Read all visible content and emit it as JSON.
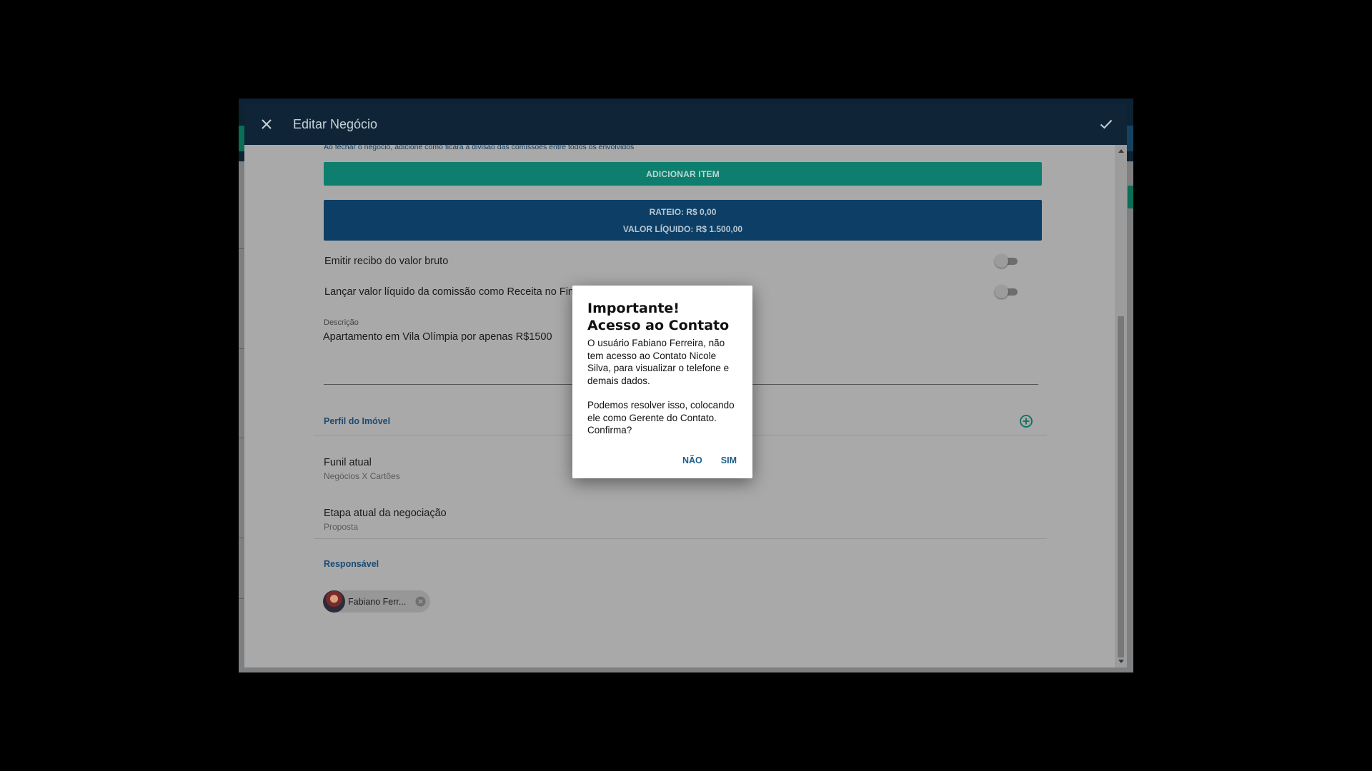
{
  "modal": {
    "title": "Editar Negócio",
    "close_icon": "close-icon",
    "confirm_icon": "check-icon"
  },
  "commission": {
    "hint": "Ao fechar o negócio, adicione como ficará a divisão das comissões entre todos os envolvidos",
    "add_item_label": "ADICIONAR ITEM",
    "rateio": "RATEIO: R$ 0,00",
    "valor_liquido": "VALOR LÍQUIDO: R$ 1.500,00"
  },
  "toggles": [
    {
      "label": "Emitir recibo do valor bruto",
      "on": false
    },
    {
      "label": "Lançar valor líquido da comissão como Receita no Financeiro",
      "on": false
    }
  ],
  "description": {
    "label": "Descrição",
    "value": "Apartamento em Vila Olímpia por apenas R$1500"
  },
  "property_profile": {
    "title": "Perfil do Imóvel"
  },
  "funnel": {
    "title": "Funil atual",
    "value": "Negócios X Cartões"
  },
  "stage": {
    "title": "Etapa atual da negociação",
    "value": "Proposta"
  },
  "responsible": {
    "title": "Responsável",
    "chip_label": "Fabiano Ferr..."
  },
  "dialog": {
    "title": "Importante! Acesso ao Contato",
    "paragraph1": "O usuário Fabiano Ferreira, não tem acesso ao Contato Nicole Silva, para visualizar o telefone e demais dados.",
    "paragraph2": "Podemos resolver isso, colocando ele como Gerente do Contato. Confirma?",
    "no_label": "NÃO",
    "yes_label": "SIM"
  },
  "colors": {
    "header": "#0f2537",
    "accent_green": "#0e7f6e",
    "accent_blue": "#0d3f66",
    "link_blue": "#1b5d8b"
  }
}
